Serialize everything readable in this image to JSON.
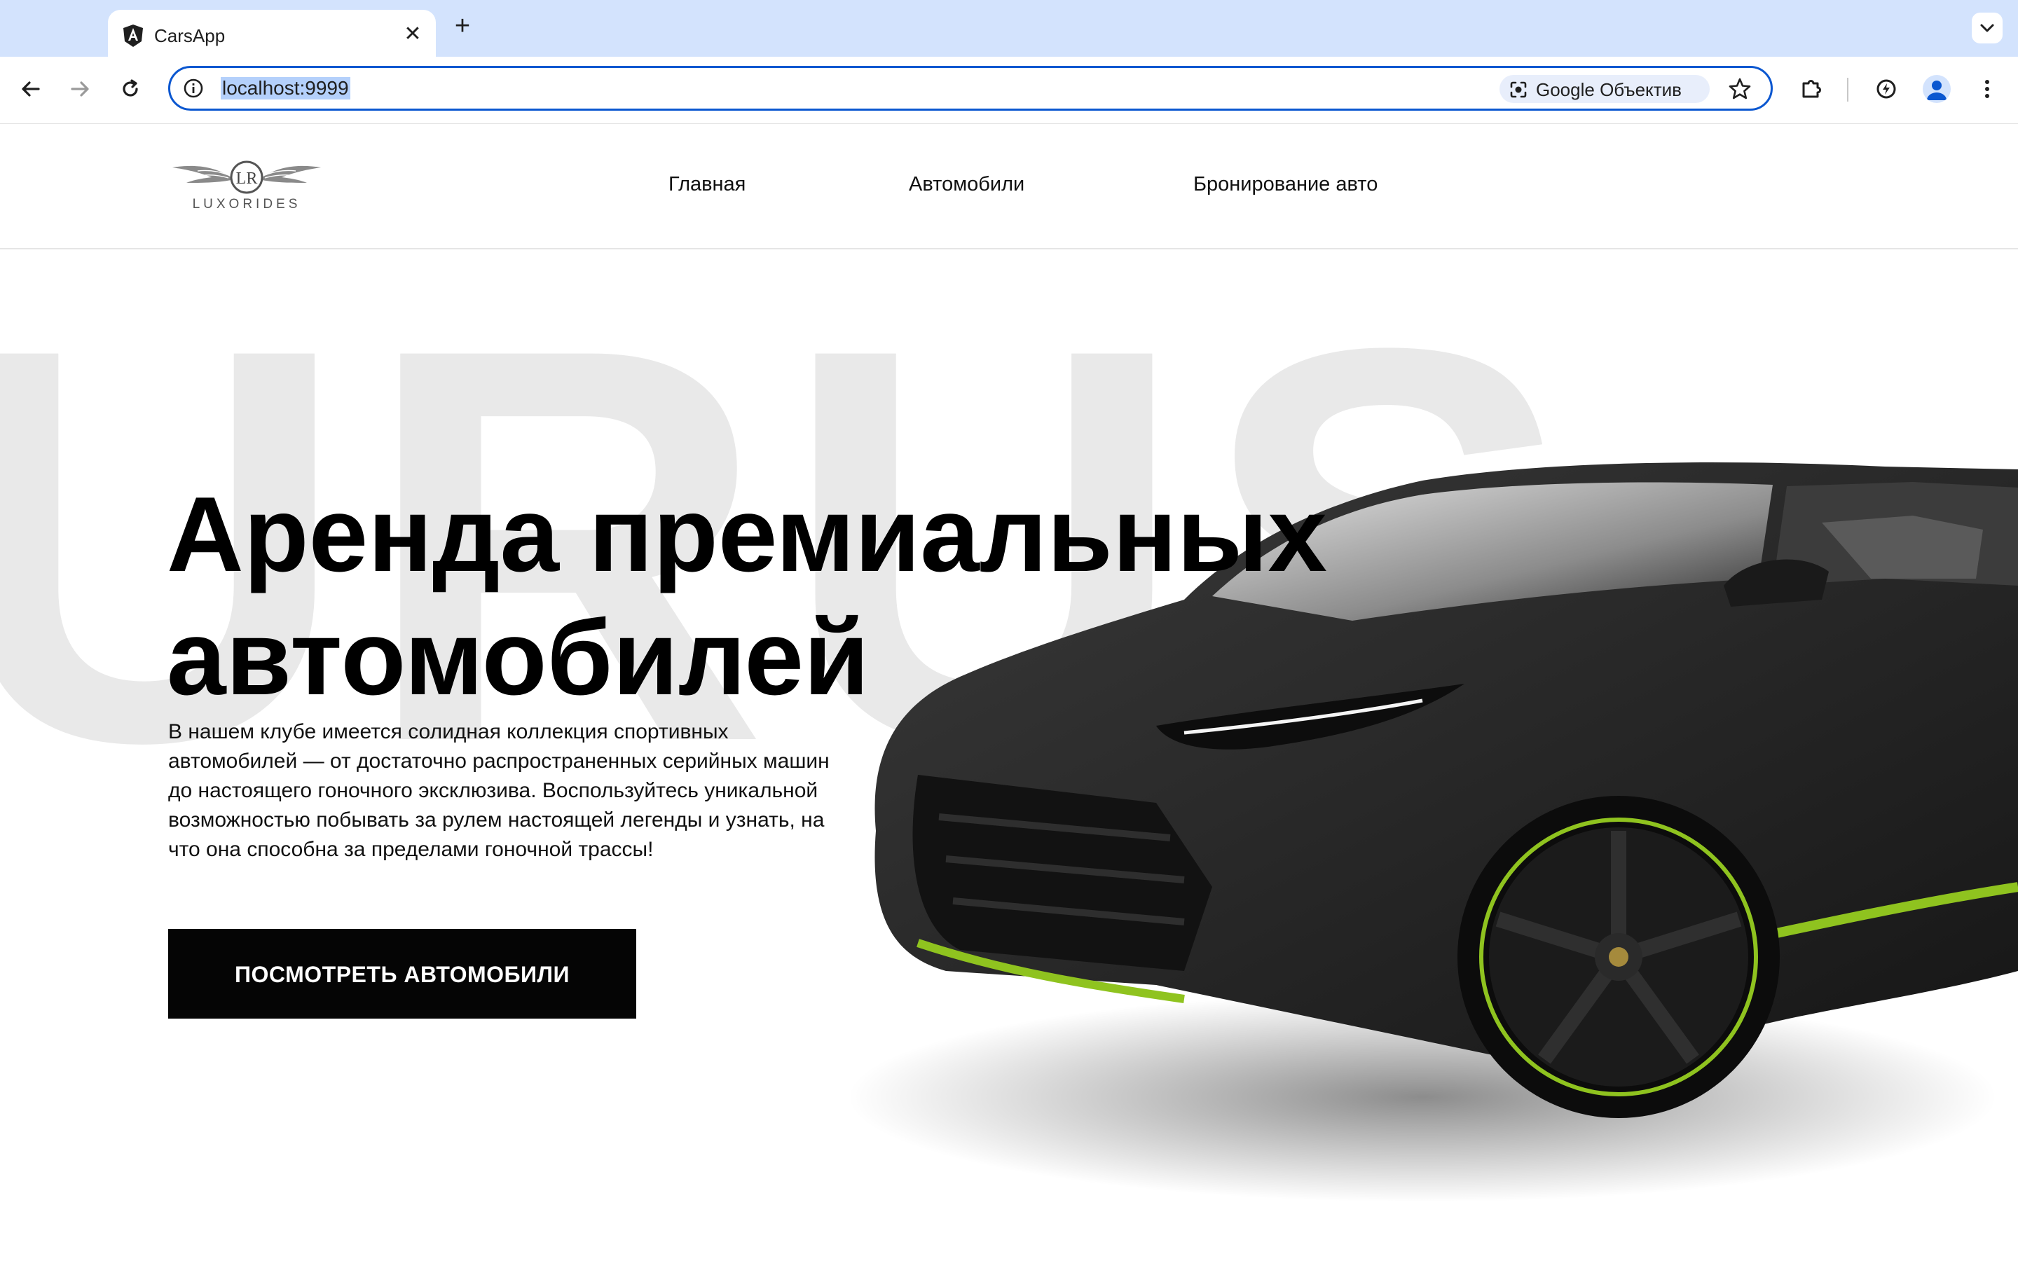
{
  "browser": {
    "tab": {
      "title": "CarsApp",
      "close_glyph": "✕"
    },
    "new_tab_glyph": "+",
    "address": {
      "url": "localhost:9999"
    },
    "lens_label": "Google Объектив",
    "icons": [
      "back-icon",
      "forward-icon",
      "reload-icon",
      "info-icon",
      "lens-icon",
      "star-icon",
      "extensions-icon",
      "performance-icon",
      "profile-icon",
      "menu-icon",
      "tab-search-icon"
    ],
    "accent_color": "#0b57d0",
    "tabstrip_color": "#d3e3fd"
  },
  "site": {
    "logo": {
      "monogram": "LR",
      "text": "LUXORIDES"
    },
    "nav": [
      {
        "label": "Главная"
      },
      {
        "label": "Автомобили"
      },
      {
        "label": "Бронирование авто"
      }
    ],
    "hero": {
      "watermark": "URUS",
      "title_line1": "Аренда премиальных",
      "title_line2": "автомобилей",
      "description": "В нашем клубе имеется солидная коллекция спортивных автомобилей — от достаточно распространенных серийных машин до настоящего гоночного эксклюзива. Воспользуйтесь уникальной возможностью побывать за рулем настоящей легенды и узнать, на что она способна за пределами гоночной трассы!",
      "cta_label": "ПОСМОТРЕТЬ АВТОМОБИЛИ",
      "car_image": "black-lamborghini-urus",
      "car_accent_color": "#8fc31f"
    }
  }
}
